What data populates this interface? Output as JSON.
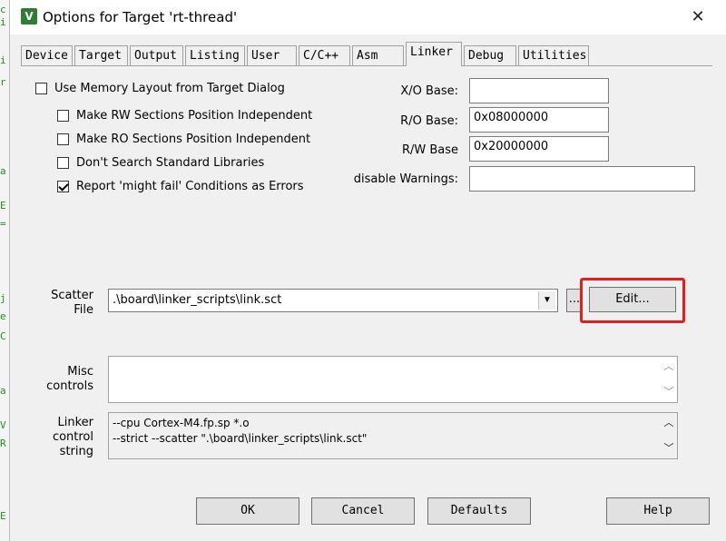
{
  "window": {
    "title": "Options for Target 'rt-thread'",
    "close_glyph": "✕",
    "icon_glyph": "V"
  },
  "tabs": [
    {
      "label": "Device"
    },
    {
      "label": "Target"
    },
    {
      "label": "Output"
    },
    {
      "label": "Listing"
    },
    {
      "label": "User"
    },
    {
      "label": "C/C++"
    },
    {
      "label": "Asm"
    },
    {
      "label": "Linker",
      "active": true
    },
    {
      "label": "Debug"
    },
    {
      "label": "Utilities"
    }
  ],
  "checkboxes": [
    {
      "label": "Use Memory Layout from Target Dialog",
      "checked": false
    },
    {
      "label": "Make RW Sections Position Independent",
      "checked": false
    },
    {
      "label": "Make RO Sections Position Independent",
      "checked": false
    },
    {
      "label": "Don't Search Standard Libraries",
      "checked": false
    },
    {
      "label": "Report 'might fail' Conditions as Errors",
      "checked": true
    }
  ],
  "base_fields": {
    "xo": {
      "label": "X/O Base:",
      "value": ""
    },
    "ro": {
      "label": "R/O Base:",
      "value": "0x08000000"
    },
    "rw": {
      "label": "R/W Base",
      "value": "0x20000000"
    },
    "disable_warnings": {
      "label": "disable Warnings:",
      "value": ""
    }
  },
  "scatter": {
    "label_line1": "Scatter",
    "label_line2": "File",
    "value": ".\\board\\linker_scripts\\link.sct",
    "browse_label": "...",
    "edit_label": "Edit..."
  },
  "misc": {
    "label_line1": "Misc",
    "label_line2": "controls",
    "value": ""
  },
  "linker_control": {
    "label_line1": "Linker",
    "label_line2": "control",
    "label_line3": "string",
    "line1": "--cpu Cortex-M4.fp.sp *.o",
    "line2": "--strict --scatter \".\\board\\linker_scripts\\link.sct\""
  },
  "buttons": {
    "ok": "OK",
    "cancel": "Cancel",
    "defaults": "Defaults",
    "help": "Help"
  },
  "colors": {
    "highlight": "#e02020",
    "dialog_bg": "#f0f0f0"
  }
}
